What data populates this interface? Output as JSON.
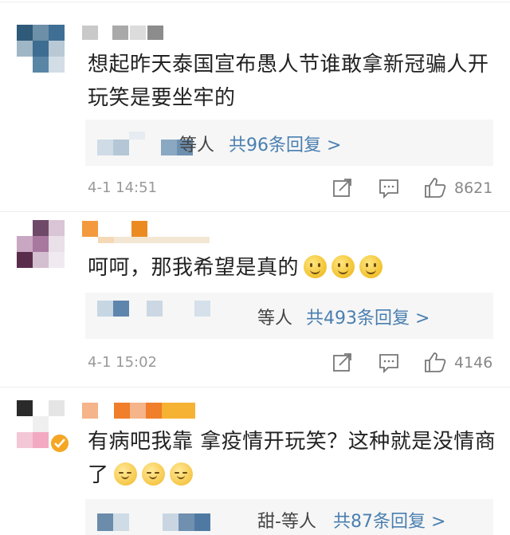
{
  "comments": [
    {
      "text": "想起昨天泰国宣布愚人节谁敢拿新冠骗人开玩笑是要坐牢的",
      "reply_suffix": "等人",
      "reply_link": "共96条回复 >",
      "timestamp": "4-1 14:51",
      "likes": "8621"
    },
    {
      "text": "呵呵，那我希望是真的",
      "reply_suffix": "等人",
      "reply_link": "共493条回复 >",
      "timestamp": "4-1 15:02",
      "likes": "4146"
    },
    {
      "text": "有病吧我靠 拿疫情开玩笑？这种就是没情商了",
      "reply_suffix": "甜-等人",
      "reply_link": "共87条回复 >"
    }
  ],
  "icons": {
    "share": "share-icon",
    "comment": "comment-icon",
    "like": "thumbs-up-icon"
  },
  "colors": {
    "link": "#4a7fb0",
    "text": "#222222",
    "meta": "#999999"
  }
}
